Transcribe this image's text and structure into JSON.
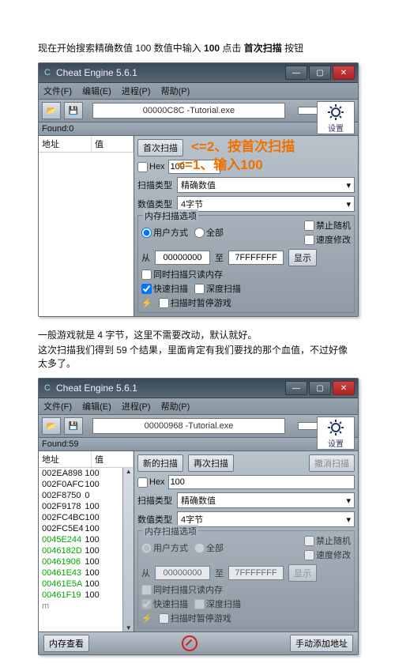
{
  "doc": {
    "caption1_prefix": "现在开始搜索精确数值 100   数值中输入 ",
    "caption1_bold1": "100",
    "caption1_mid": " 点击 ",
    "caption1_bold2": "首次扫描",
    "caption1_suffix": " 按钮",
    "caption2_line1": "一般游戏就是 4 字节，这里不需要改动，默认就好。",
    "caption2_line2": "这次扫描我们得到 59 个结果，里面肯定有我们要找的那个血值，不过好像太多了。"
  },
  "app_title": "Cheat Engine 5.6.1",
  "menu": {
    "file": "文件(F)",
    "edit": "编辑(E)",
    "process": "进程(P)",
    "help": "帮助(P)"
  },
  "toolbar": {
    "target1": "00000C8C -Tutorial.exe",
    "target2": "00000968 -Tutorial.exe"
  },
  "found": {
    "label": "Found:",
    "count1": "0",
    "count2": "59"
  },
  "columns": {
    "addr": "地址",
    "value": "值"
  },
  "results2": [
    {
      "addr": "002EA898",
      "val": "100",
      "green": false
    },
    {
      "addr": "002F0AFC",
      "val": "100",
      "green": false
    },
    {
      "addr": "002F8750",
      "val": "0",
      "green": false
    },
    {
      "addr": "002F9178",
      "val": "100",
      "green": false
    },
    {
      "addr": "002FC4BC",
      "val": "100",
      "green": false
    },
    {
      "addr": "002FC5E4",
      "val": "100",
      "green": false
    },
    {
      "addr": "0045E244",
      "val": "100",
      "green": true
    },
    {
      "addr": "0046182D",
      "val": "100",
      "green": true
    },
    {
      "addr": "00461906",
      "val": "100",
      "green": true
    },
    {
      "addr": "00461E43",
      "val": "100",
      "green": true
    },
    {
      "addr": "00461E5A",
      "val": "100",
      "green": true
    },
    {
      "addr": "00461F19",
      "val": "100",
      "green": true
    }
  ],
  "buttons": {
    "first_scan": "首次扫描",
    "new_scan": "新的扫描",
    "next_scan": "再次扫描",
    "undo_scan": "撤消扫描",
    "settings": "设置",
    "show": "显示",
    "mem_view": "内存查看",
    "manual_add": "手动添加地址"
  },
  "labels": {
    "hex": "Hex",
    "scan_type": "扫描类型",
    "value_type": "数值类型",
    "mem_opts": "内存扫描选项",
    "user_mode": "用户方式",
    "all": "全部",
    "from": "从",
    "to": "至",
    "same_read": "同时扫描只读内存",
    "fast_scan": "快速扫描",
    "deep_scan": "深度扫描",
    "pause_game": "扫描时暂停游戏",
    "forbid_rand": "禁止随机",
    "speed_hack": "速度修改"
  },
  "dropdowns": {
    "scan_type_value": "精确数值",
    "value_type_value": "4字节"
  },
  "values": {
    "hex_value": "100",
    "range_from": "00000000",
    "range_to": "7FFFFFFF"
  },
  "overlays": {
    "line1": "<=2、按首次扫描",
    "line2": "<=1、输入100"
  }
}
